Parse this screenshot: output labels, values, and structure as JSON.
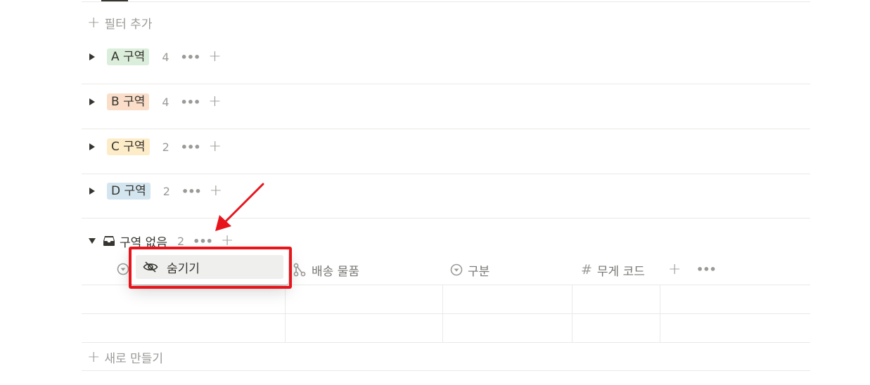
{
  "filter": {
    "label": "필터 추가"
  },
  "groups": [
    {
      "name": "A 구역",
      "count": "4",
      "color": "#dbeddb"
    },
    {
      "name": "B 구역",
      "count": "4",
      "color": "#fadec9"
    },
    {
      "name": "C 구역",
      "count": "2",
      "color": "#fdecc8"
    },
    {
      "name": "D 구역",
      "count": "2",
      "color": "#d3e5ef"
    }
  ],
  "no_group": {
    "name": "구역 없음",
    "count": "2"
  },
  "columns": [
    {
      "name": "배송 물품",
      "icon": "relation-icon"
    },
    {
      "name": "구분",
      "icon": "select-icon"
    },
    {
      "name": "무게 코드",
      "icon": "number-icon"
    }
  ],
  "context_menu": {
    "hide_label": "숨기기"
  },
  "new_row": {
    "label": "새로 만들기"
  },
  "accent": {
    "highlight": "#e8141c"
  }
}
